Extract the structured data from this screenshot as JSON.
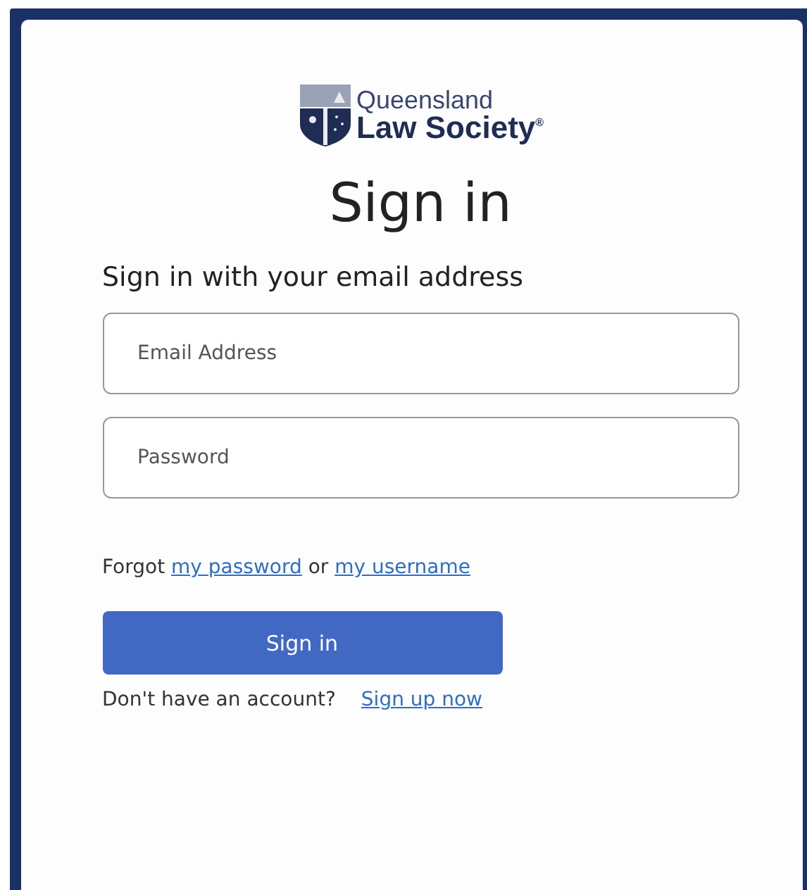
{
  "logo": {
    "line_1": "Queensland",
    "line_2": "Law Society$^{®}$"
  },
  "title": "Sign in",
  "subtitle": "Sign in with your email address",
  "fields": [
    {
      "placeholder": "Email Address"
    },
    {
      "placeholder": "Password"
    }
  ],
  "forgot": {
    "prefix": "Forgot",
    "link_1": "my password",
    "middle": "or",
    "link_2": "my username"
  },
  "button": "Sign in",
  "signup": {
    "prompt": "Don't have an account?",
    "link": "Sign up now"
  }
}
